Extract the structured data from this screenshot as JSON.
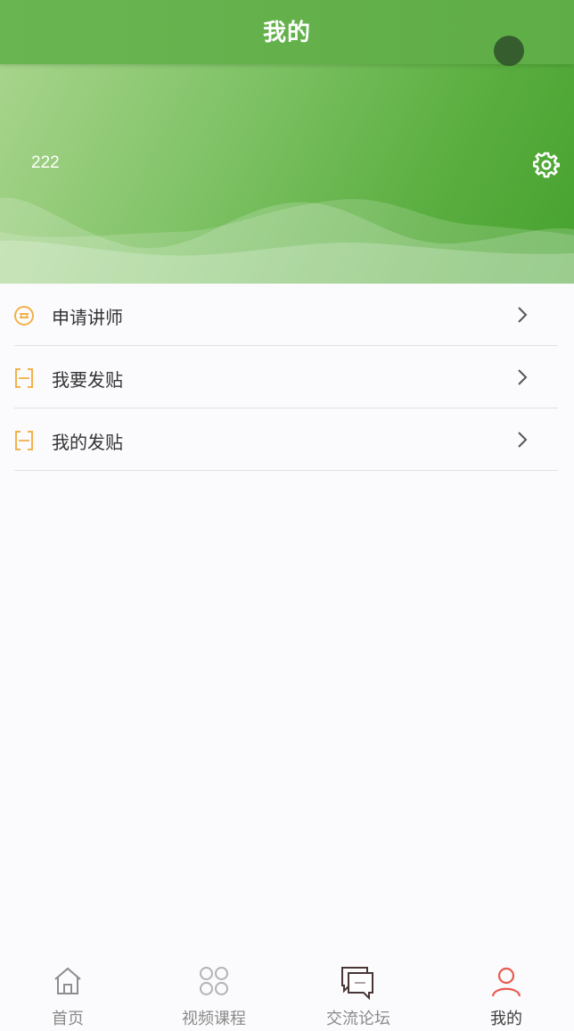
{
  "header": {
    "title": "我的"
  },
  "profile": {
    "username": "222",
    "settings_icon": "gear-icon"
  },
  "menu": {
    "items": [
      {
        "label": "申请讲师",
        "icon": "teacher-badge-icon"
      },
      {
        "label": "我要发贴",
        "icon": "bracket-frame-icon"
      },
      {
        "label": "我的发贴",
        "icon": "bracket-frame-icon"
      }
    ]
  },
  "tabbar": {
    "items": [
      {
        "label": "首页",
        "icon": "home-icon",
        "active": false
      },
      {
        "label": "视频课程",
        "icon": "four-petal-icon",
        "active": false
      },
      {
        "label": "交流论坛",
        "icon": "chat-bubbles-icon",
        "active": false
      },
      {
        "label": "我的",
        "icon": "person-icon",
        "active": true
      }
    ]
  },
  "colors": {
    "header_green": "#66b24f",
    "banner_green": "#5aae40",
    "menu_icon_orange": "#f1b14a",
    "active_tab_icon": "#e85a4f"
  }
}
